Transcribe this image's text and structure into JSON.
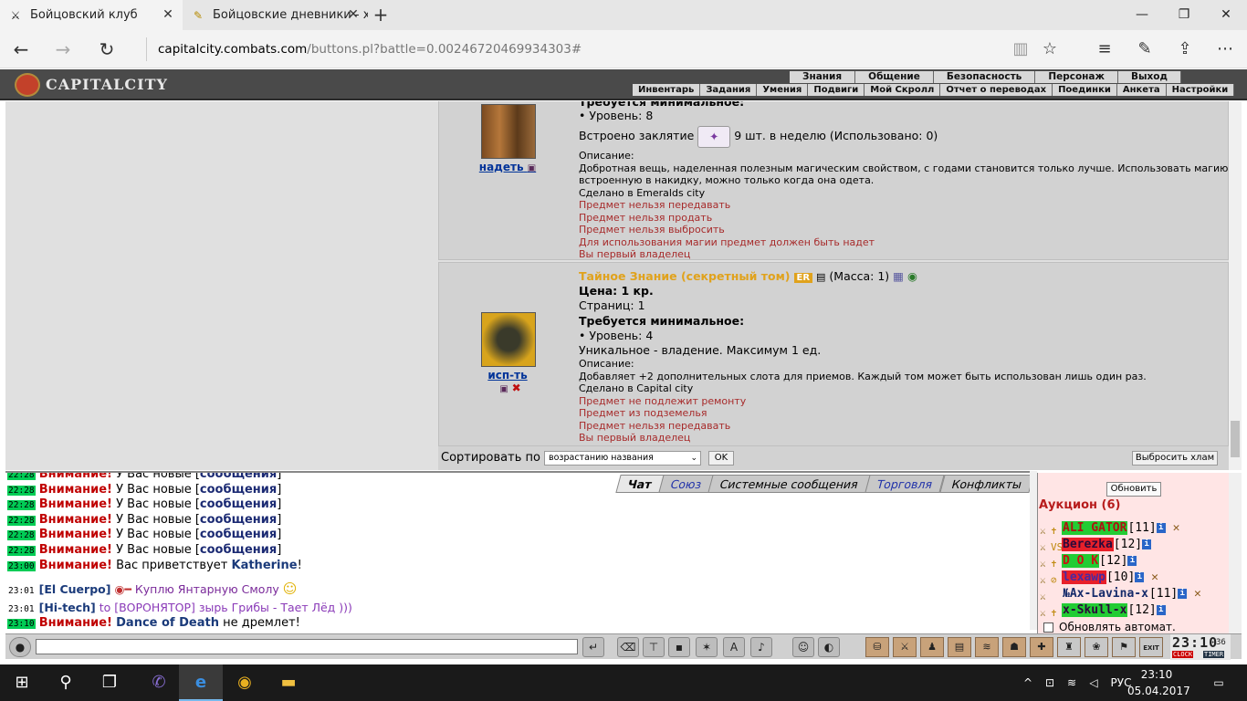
{
  "browser": {
    "tabs": [
      {
        "title": "Бойцовский клуб",
        "icon": "swords-icon"
      },
      {
        "title": "Бойцовские дневники - х-:",
        "icon": "pen-icon"
      }
    ],
    "url_host": "capitalcity.combats.com",
    "url_path": "/buttons.pl?battle=0.00246720469934303#",
    "close_symbol": "✕",
    "new_tab_symbol": "+",
    "win_minimize": "—",
    "win_maximize": "❐",
    "win_close": "✕"
  },
  "game": {
    "logo": "CAPITALCITY",
    "menu_top": [
      "Знания",
      "Общение",
      "Безопасность",
      "Персонаж",
      "Выход"
    ],
    "menu_sub": [
      "Инвентарь",
      "Задания",
      "Умения",
      "Подвиги",
      "Мой Скролл",
      "Отчет о переводах",
      "Поединки",
      "Анкета",
      "Настройки"
    ]
  },
  "items": [
    {
      "action": "надеть",
      "lines": [
        "Требуется минимальное:",
        "• Уровень: 8",
        "Встроено заклятие",
        "9 шт. в неделю (Использовано: 0)",
        "Описание:",
        "Добротная вещь, наделенная полезным магическим свойством, с годами становится только лучше. Использовать магию,",
        "встроенную в накидку, можно только когда она одета.",
        "Сделано в Emeralds city"
      ],
      "restrictions": [
        "Предмет нельзя передавать",
        "Предмет нельзя продать",
        "Предмет нельзя выбросить",
        "Для использования магии предмет должен быть надет",
        "Вы первый владелец"
      ]
    },
    {
      "action": "исп-ть",
      "title": "Тайное Знание (секретный том)",
      "badge": "ER",
      "mass": "(Масса: 1)",
      "price": "Цена: 1 кр.",
      "pages": "Страниц: 1",
      "req": "Требуется минимальное:",
      "level": "• Уровень: 4",
      "unique": "Уникальное - владение. Максимум 1 ед.",
      "desc_label": "Описание:",
      "desc": "Добавляет +2 дополнительных слота для приемов. Каждый том может быть использован лишь один раз.",
      "made": "Сделано в Capital city",
      "restrictions": [
        "Предмет не подлежит ремонту",
        "Предмет из подземелья",
        "Предмет нельзя передавать",
        "Вы первый владелец"
      ]
    }
  ],
  "sort": {
    "label": "Сортировать по",
    "value": "возрастанию названия",
    "ok": "OK",
    "drop_junk": "Выбросить хлам"
  },
  "chat": {
    "tabs": [
      "Чат",
      "Союз",
      "Системные сообщения",
      "Торговля",
      "Конфликты"
    ],
    "notice_lines": [
      {
        "time": "22:28",
        "warn": "Внимание!",
        "text": " У Вас новые [",
        "link": "сообщения",
        "end": "]"
      },
      {
        "time": "22:28",
        "warn": "Внимание!",
        "text": " У Вас новые [",
        "link": "сообщения",
        "end": "]"
      },
      {
        "time": "22:28",
        "warn": "Внимание!",
        "text": " У Вас новые [",
        "link": "сообщения",
        "end": "]"
      },
      {
        "time": "22:28",
        "warn": "Внимание!",
        "text": " У Вас новые [",
        "link": "сообщения",
        "end": "]"
      },
      {
        "time": "22:28",
        "warn": "Внимание!",
        "text": " У Вас новые [",
        "link": "сообщения",
        "end": "]"
      },
      {
        "time": "22:28",
        "warn": "Внимание!",
        "text": " У Вас новые [",
        "link": "сообщения",
        "end": "]"
      }
    ],
    "welcome": {
      "time": "23:00",
      "warn": "Внимание!",
      "text": " Вас приветствует ",
      "name": "Katherine",
      "end": "!"
    },
    "msg1": {
      "time": "23:01",
      "nick": "El Cuerpo",
      "text": "Куплю Янтарную Смолу"
    },
    "msg2": {
      "time": "23:01",
      "nick": "Hi-tech",
      "text": " to [ВОРОНЯТОР] зырь Грибы - Тает Лёд )))"
    },
    "msg3": {
      "time": "23:10",
      "warn": "Внимание!",
      "name": "Dance of Death",
      "text": " не дремлет!"
    }
  },
  "auction": {
    "refresh": "Обновить",
    "title": "Аукцион (6)",
    "rows": [
      {
        "name": "ALI GATOR",
        "level": "[11]",
        "bg": "#22cc33",
        "color": "#b01010"
      },
      {
        "name": "Berezka",
        "level": "[12]",
        "bg": "#e8202a",
        "color": "#2a0a3a"
      },
      {
        "name": "D O K",
        "level": "[12]",
        "bg": "#22cc33",
        "color": "#cc1010"
      },
      {
        "name": "lexawp",
        "level": "[10]",
        "bg": "#e8202a",
        "color": "#4a2aa0"
      },
      {
        "name": "№Ax-Lavina-x",
        "level": "[11]",
        "bg": "transparent",
        "color": "#152a6a"
      },
      {
        "name": "x-Skull-x",
        "level": "[12]",
        "bg": "#22cc33",
        "color": "#2a0a3a"
      }
    ],
    "auto": "Обновлять автомат."
  },
  "clock": {
    "time": "23:10",
    "sec": "36",
    "clock_label": "CLOCK",
    "timer_label": "TIMER",
    "exit": "EXIT"
  },
  "taskbar": {
    "lang": "РУС",
    "time": "23:10",
    "date": "05.04.2017"
  }
}
